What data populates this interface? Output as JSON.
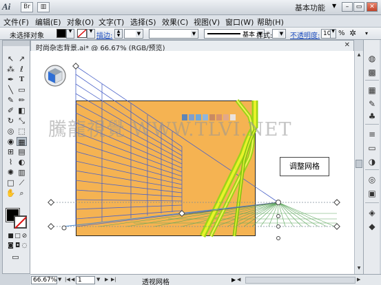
{
  "titlebar": {
    "app": "Ai",
    "bridge_icon": "Br",
    "workspace": "基本功能",
    "minimize": "–",
    "restore": "▭",
    "close": "✕"
  },
  "menu": [
    "文件(F)",
    "编辑(E)",
    "对象(O)",
    "文字(T)",
    "选择(S)",
    "效果(C)",
    "视图(V)",
    "窗口(W)",
    "帮助(H)"
  ],
  "control": {
    "selection": "未选择对象",
    "stroke_label": "描边:",
    "style_text": "基本",
    "styles_label": "样式:",
    "opacity_label": "不透明度:",
    "opacity_value": "100",
    "opacity_unit": "%"
  },
  "document": {
    "tab_title": "时尚杂志背景.ai* @ 66.67% (RGB/预览)",
    "close": "✕"
  },
  "canvas": {
    "watermark": "騰龍視覺 WWW.TLVI.NET",
    "callout": "调整网格",
    "palette_colors": [
      "#5f86b8",
      "#7fa0cf",
      "#6fa8dc",
      "#8fb6de",
      "#c98a62",
      "#d7936e",
      "#e2a889",
      "#eae2dc"
    ],
    "artboard_color": "#f5b352"
  },
  "status": {
    "zoom": "66.67%",
    "page": "1",
    "tool_name": "透视网格"
  },
  "icons": {
    "tools": [
      "selection-arrow-icon",
      "direct-selection-icon",
      "magic-wand-icon",
      "lasso-icon",
      "pen-icon",
      "type-icon",
      "line-icon",
      "rectangle-icon",
      "paintbrush-icon",
      "pencil-icon",
      "blob-brush-icon",
      "eraser-icon",
      "rotate-icon",
      "scale-icon",
      "warp-icon",
      "free-transform-icon",
      "shape-builder-icon",
      "perspective-grid-icon",
      "mesh-icon",
      "gradient-icon",
      "eyedropper-icon",
      "blend-icon",
      "symbol-sprayer-icon",
      "column-graph-icon",
      "artboard-icon",
      "slice-icon",
      "hand-icon",
      "zoom-icon"
    ]
  }
}
